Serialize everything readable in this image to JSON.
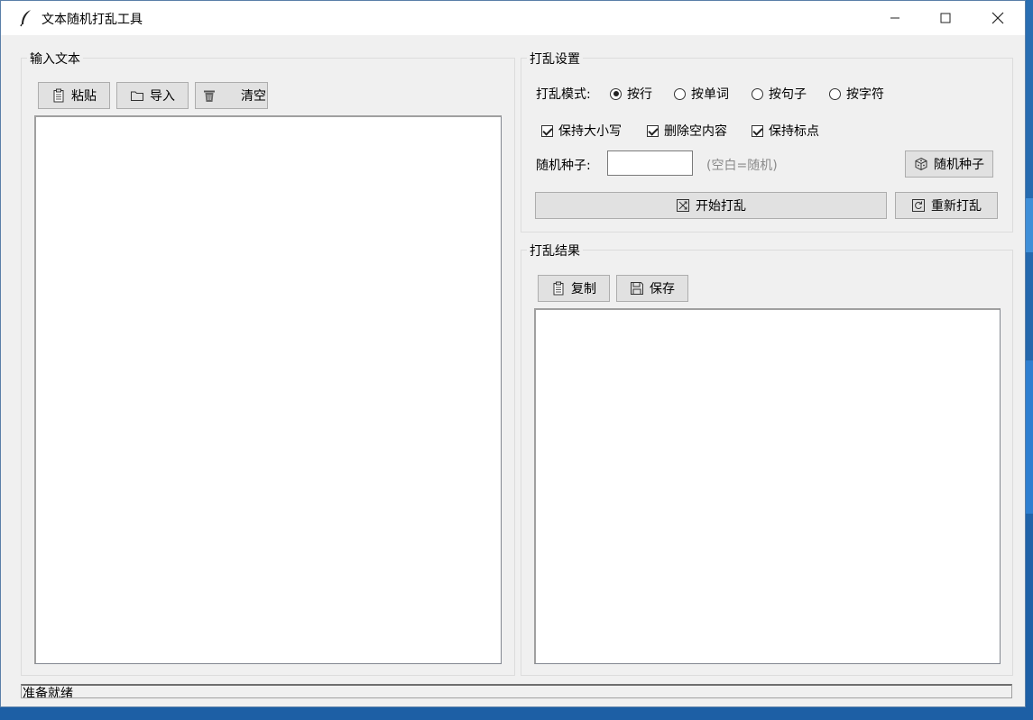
{
  "window": {
    "title": "文本随机打乱工具",
    "controls": {
      "minimize": "minimize",
      "maximize": "maximize",
      "close": "close"
    }
  },
  "input_group": {
    "label": "输入文本",
    "buttons": {
      "paste": "粘贴",
      "import": "导入",
      "clear": "清空"
    },
    "text": ""
  },
  "settings_group": {
    "label": "打乱设置",
    "mode_label": "打乱模式:",
    "modes": [
      "按行",
      "按单词",
      "按句子",
      "按字符"
    ],
    "selected_mode": "按行",
    "options": [
      {
        "label": "保持大小写",
        "checked": true
      },
      {
        "label": "删除空内容",
        "checked": true
      },
      {
        "label": "保持标点",
        "checked": true
      }
    ],
    "seed_label": "随机种子:",
    "seed_value": "",
    "seed_hint": "(空白=随机)",
    "random_seed_button": "随机种子",
    "start_button": "开始打乱",
    "reshuffle_button": "重新打乱"
  },
  "result_group": {
    "label": "打乱结果",
    "buttons": {
      "copy": "复制",
      "save": "保存"
    },
    "text": ""
  },
  "status": {
    "text": "准备就绪"
  }
}
